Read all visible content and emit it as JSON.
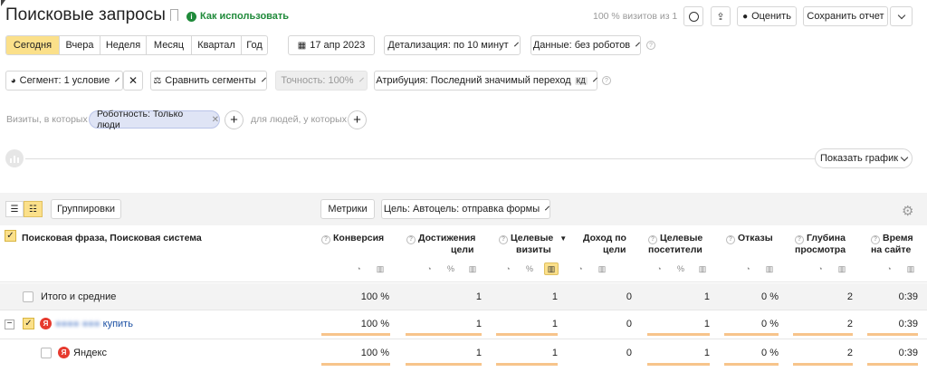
{
  "header": {
    "title": "Поисковые запросы",
    "how_to_use": "Как использовать",
    "visits_share": "100 % визитов из 1",
    "rate_label": "Оценить",
    "save_report_label": "Сохранить отчет"
  },
  "periods": [
    {
      "label": "Сегодня",
      "active": true
    },
    {
      "label": "Вчера",
      "active": false
    },
    {
      "label": "Неделя",
      "active": false
    },
    {
      "label": "Месяц",
      "active": false
    },
    {
      "label": "Квартал",
      "active": false
    },
    {
      "label": "Год",
      "active": false
    }
  ],
  "toolbar": {
    "date": "17 апр 2023",
    "detail": "Детализация: по 10 минут",
    "data_filter": "Данные: без роботов",
    "segment": "Сегмент: 1 условие",
    "compare": "Сравнить сегменты",
    "accuracy": "Точность: 100%",
    "attribution": "Атрибуция: Последний значимый переход",
    "attribution_badge": "КД"
  },
  "filters": {
    "visits_label": "Визиты, в которых",
    "chip": "Роботность: Только люди",
    "people_label": "для людей, у которых"
  },
  "chart": {
    "show_chart": "Показать график"
  },
  "table_toolbar": {
    "groupings": "Группировки",
    "metrics": "Метрики",
    "goal": "Цель: Автоцель: отправка формы"
  },
  "columns": {
    "dimension": "Поисковая фраза, Поисковая система",
    "conversion": "Конверсия",
    "goal_reaches_1": "Достижения",
    "goal_reaches_2": "цели",
    "target_visits_1": "Целевые",
    "target_visits_2": "визиты",
    "income_1": "Доход по",
    "income_2": "цели",
    "target_visitors_1": "Целевые",
    "target_visitors_2": "посетители",
    "bounces": "Отказы",
    "depth_1": "Глубина",
    "depth_2": "просмотра",
    "time_1": "Время",
    "time_2": "на сайте",
    "sort_arrow": "▼"
  },
  "rows": [
    {
      "label": "Итого и средние",
      "conversion": "100 %",
      "reaches": "1",
      "visits": "1",
      "income": "0",
      "visitors": "1",
      "bounces": "0 %",
      "depth": "2",
      "time": "0:39"
    },
    {
      "label_blur": "●●●● ●●●",
      "label": "купить",
      "conversion": "100 %",
      "reaches": "1",
      "visits": "1",
      "income": "0",
      "visitors": "1",
      "bounces": "0 %",
      "depth": "2",
      "time": "0:39"
    },
    {
      "label": "Яндекс",
      "conversion": "100 %",
      "reaches": "1",
      "visits": "1",
      "income": "0",
      "visitors": "1",
      "bounces": "0 %",
      "depth": "2",
      "time": "0:39"
    }
  ],
  "colors": {
    "accent": "#fbe08a",
    "bar": "#f7c48b",
    "link": "#1a4fa3",
    "green": "#1f8a3a",
    "yandex": "#e63a2e"
  }
}
